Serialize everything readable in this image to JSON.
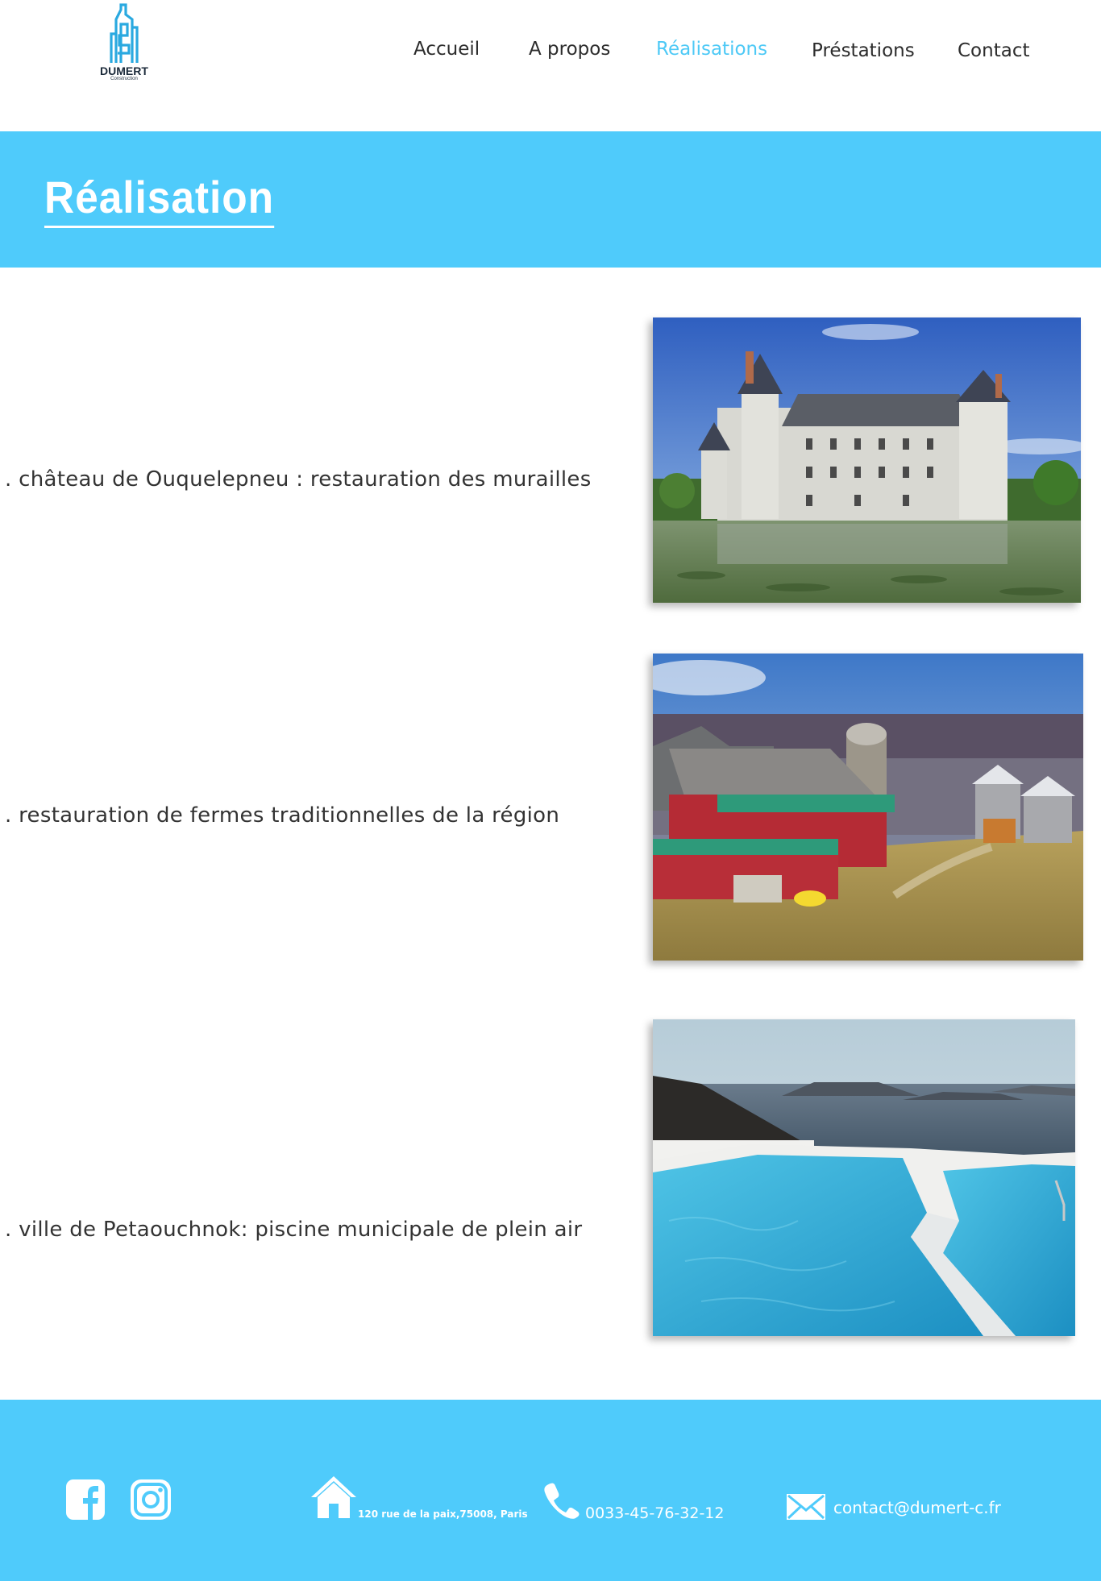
{
  "header": {
    "logo": {
      "name": "DUMERT",
      "tagline": "Construction"
    },
    "nav": [
      {
        "label": "Accueil"
      },
      {
        "label": "A propos"
      },
      {
        "label": "Réalisations",
        "active": true
      },
      {
        "label": "Préstations"
      },
      {
        "label": "Contact"
      }
    ]
  },
  "banner": {
    "title": "Réalisation"
  },
  "projects": [
    {
      "label": ". château de Ouquelepneu : restauration des murailles",
      "image": "chateau"
    },
    {
      "label": ". restauration de fermes traditionnelles de la région",
      "image": "farm"
    },
    {
      "label": ". ville de Petaouchnok: piscine municipale de plein air",
      "image": "pool"
    }
  ],
  "footer": {
    "social": [
      "facebook-icon",
      "instagram-icon"
    ],
    "address": "120 rue de la paix,75008, Paris",
    "phone": "0033-45-76-32-12",
    "email": "contact@dumert-c.fr"
  },
  "colors": {
    "accent": "#4fcbfb",
    "nav_active": "#4dc9f6",
    "text": "#333333"
  }
}
